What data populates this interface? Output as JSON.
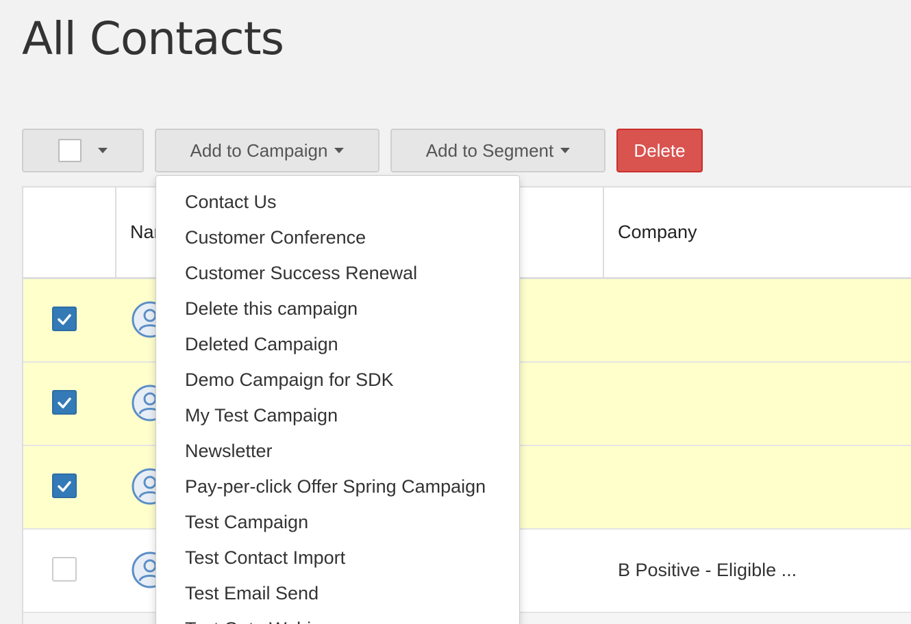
{
  "page": {
    "title": "All Contacts"
  },
  "toolbar": {
    "add_to_campaign": "Add to Campaign",
    "add_to_segment": "Add to Segment",
    "delete": "Delete"
  },
  "table": {
    "headers": {
      "name": "Name",
      "company": "Company"
    },
    "rows": [
      {
        "checked": true,
        "company": ""
      },
      {
        "checked": true,
        "company": ""
      },
      {
        "checked": true,
        "company": ""
      },
      {
        "checked": false,
        "company": "B Positive - Eligible ..."
      }
    ]
  },
  "campaign_menu": {
    "items": [
      "Contact Us",
      "Customer Conference",
      "Customer Success Renewal",
      "Delete this campaign",
      "Deleted Campaign",
      "Demo Campaign for SDK",
      "My Test Campaign",
      "Newsletter",
      "Pay-per-click Offer Spring Campaign",
      "Test Campaign",
      "Test Contact Import",
      "Test Email Send",
      "Test Goto Webinar"
    ]
  },
  "colors": {
    "selected_row": "#ffffcc",
    "checkbox_checked": "#337ab7",
    "delete_button": "#d9534f",
    "avatar": "#5b8fc7"
  }
}
